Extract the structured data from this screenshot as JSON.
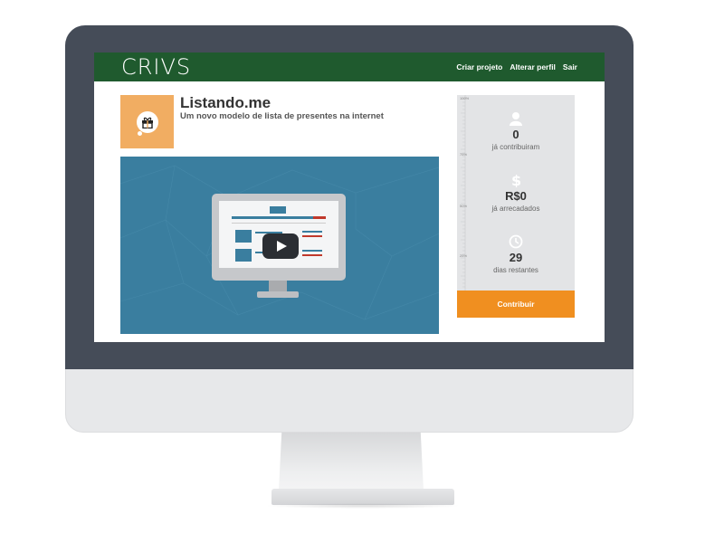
{
  "brand": {
    "logo_text": "CRIVS"
  },
  "nav": {
    "items": [
      "Criar projeto",
      "Alterar perfil",
      "Sair"
    ]
  },
  "project": {
    "title": "Listando.me",
    "subtitle": "Um novo modelo de lista de presentes na internet",
    "thumbnail_icon": "gift-icon",
    "thumbnail_color": "#f1ad62"
  },
  "video": {
    "play_icon": "play-icon",
    "background_color": "#3a7e9f"
  },
  "stats": {
    "progress_ticks": [
      "100%",
      "75%",
      "50%",
      "25%"
    ],
    "contributors": {
      "icon": "user-icon",
      "value": "0",
      "label": "já contribuiram"
    },
    "raised": {
      "icon": "dollar-icon",
      "value": "R$0",
      "label": "já arrecadados"
    },
    "days": {
      "icon": "clock-icon",
      "value": "29",
      "label": "dias restantes"
    }
  },
  "cta": {
    "label": "Contribuir",
    "color": "#f08f20"
  },
  "colors": {
    "navbar": "#1f5a2e",
    "monitor_bezel": "#454c58"
  }
}
